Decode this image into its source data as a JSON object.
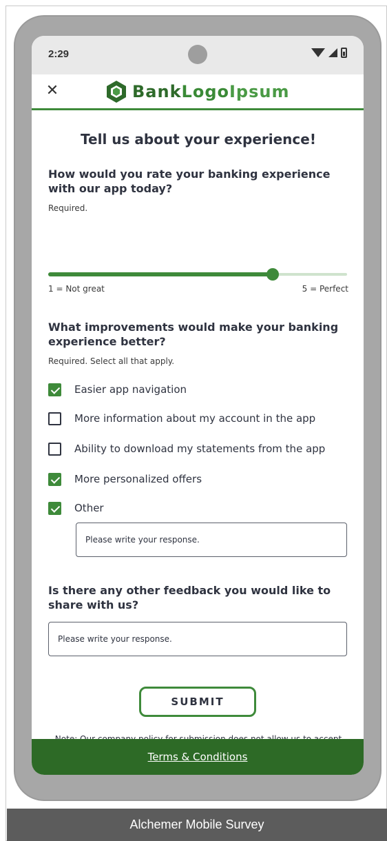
{
  "status_bar": {
    "time": "2:29"
  },
  "brand": {
    "logo_part1": "Bank",
    "logo_part2": "Logo",
    "logo_part3": "Ipsum",
    "color": "#3e8a3a"
  },
  "survey": {
    "title": "Tell us about your experience!",
    "q1": {
      "title": "How would you rate your banking experience with our app today?",
      "required": "Required.",
      "rating_value": 4,
      "rating_min": 1,
      "rating_max": 5,
      "min_label": "1 = Not great",
      "max_label": "5 = Perfect"
    },
    "q2": {
      "title": "What improvements would make your banking experience better?",
      "required": "Required. Select all that apply.",
      "options": [
        {
          "label": "Easier app navigation",
          "checked": true
        },
        {
          "label": "More information about my account in the app",
          "checked": false
        },
        {
          "label": "Ability to download my statements from the app",
          "checked": false
        },
        {
          "label": "More personalized offers",
          "checked": true
        },
        {
          "label": "Other",
          "checked": true
        }
      ],
      "other_placeholder": "Please write your response."
    },
    "q3": {
      "title": "Is there any other feedback you would like to share with us?",
      "placeholder": "Please write your response."
    },
    "submit_label": "SUBMIT",
    "note": "Note: Our company policy for submission does not allow us to accept ideas or materials we have not specifically requested."
  },
  "footer": {
    "link": "Terms & Conditions"
  },
  "caption": "Alchemer Mobile Survey"
}
